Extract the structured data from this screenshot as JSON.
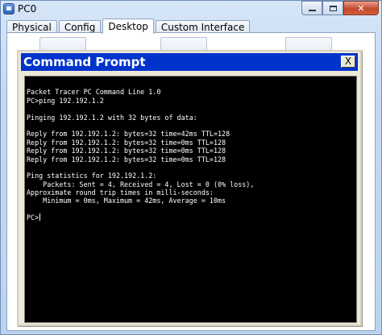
{
  "window": {
    "title": "PC0"
  },
  "tabs": [
    {
      "label": "Physical",
      "active": false
    },
    {
      "label": "Config",
      "active": false
    },
    {
      "label": "Desktop",
      "active": true
    },
    {
      "label": "Custom Interface",
      "active": false
    }
  ],
  "command_prompt": {
    "title": "Command Prompt",
    "close_label": "X",
    "lines": [
      "",
      "Packet Tracer PC Command Line 1.0",
      "PC>ping 192.192.1.2",
      "",
      "Pinging 192.192.1.2 with 32 bytes of data:",
      "",
      "Reply from 192.192.1.2: bytes=32 time=42ms TTL=128",
      "Reply from 192.192.1.2: bytes=32 time=0ms TTL=128",
      "Reply from 192.192.1.2: bytes=32 time=0ms TTL=128",
      "Reply from 192.192.1.2: bytes=32 time=0ms TTL=128",
      "",
      "Ping statistics for 192.192.1.2:",
      "    Packets: Sent = 4, Received = 4, Lost = 0 (0% loss),",
      "Approximate round trip times in milli-seconds:",
      "    Minimum = 0ms, Maximum = 42ms, Average = 10ms",
      "",
      "PC>"
    ]
  }
}
